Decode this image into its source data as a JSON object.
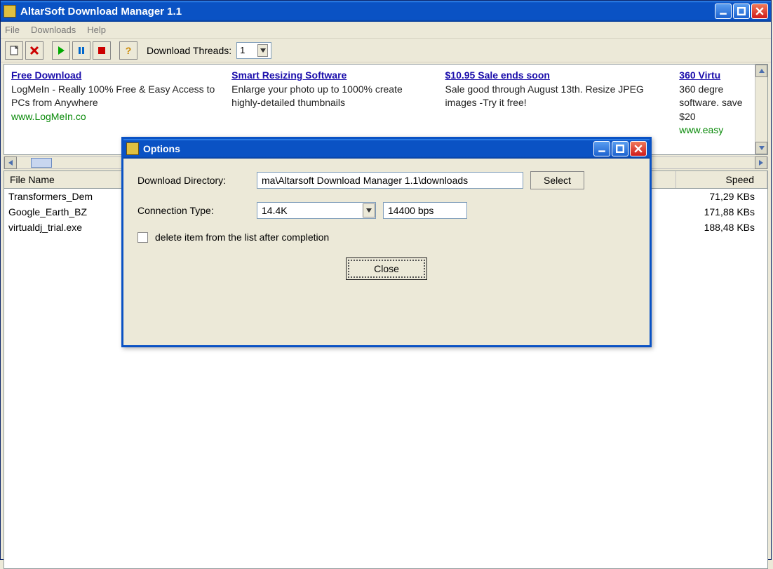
{
  "window": {
    "title": "AltarSoft Download Manager 1.1"
  },
  "menubar": {
    "items": [
      "File",
      "Downloads",
      "Help"
    ]
  },
  "toolbar": {
    "threads_label": "Download Threads:",
    "threads_value": "1"
  },
  "ads": [
    {
      "title": "Free Download",
      "desc": "LogMeIn - Really 100% Free & Easy Access to PCs from Anywhere",
      "url": "www.LogMeIn.co"
    },
    {
      "title": "Smart Resizing Software",
      "desc": "Enlarge your photo up to 1000% create highly-detailed thumbnails",
      "url": ""
    },
    {
      "title": "$10.95 Sale ends soon",
      "desc": "Sale good through August 13th. Resize JPEG images -Try it free!",
      "url": ""
    },
    {
      "title": "360 Virtu",
      "desc": "360 degre software. save $20",
      "url": "www.easy"
    }
  ],
  "table": {
    "columns": {
      "filename": "File Name",
      "speed": "Speed"
    },
    "rows": [
      {
        "filename": "Transformers_Dem",
        "speed": "71,29 KBs"
      },
      {
        "filename": "Google_Earth_BZ",
        "speed": "171,88 KBs"
      },
      {
        "filename": "virtualdj_trial.exe",
        "speed": "188,48 KBs"
      }
    ]
  },
  "dialog": {
    "title": "Options",
    "dir_label": "Download Directory:",
    "dir_value": "ma\\Altarsoft Download Manager 1.1\\downloads",
    "select_btn": "Select",
    "conn_label": "Connection Type:",
    "conn_value": "14.4K",
    "bps_value": "14400 bps",
    "delete_check_label": "delete item from the list after completion",
    "delete_checked": false,
    "close_btn": "Close"
  }
}
